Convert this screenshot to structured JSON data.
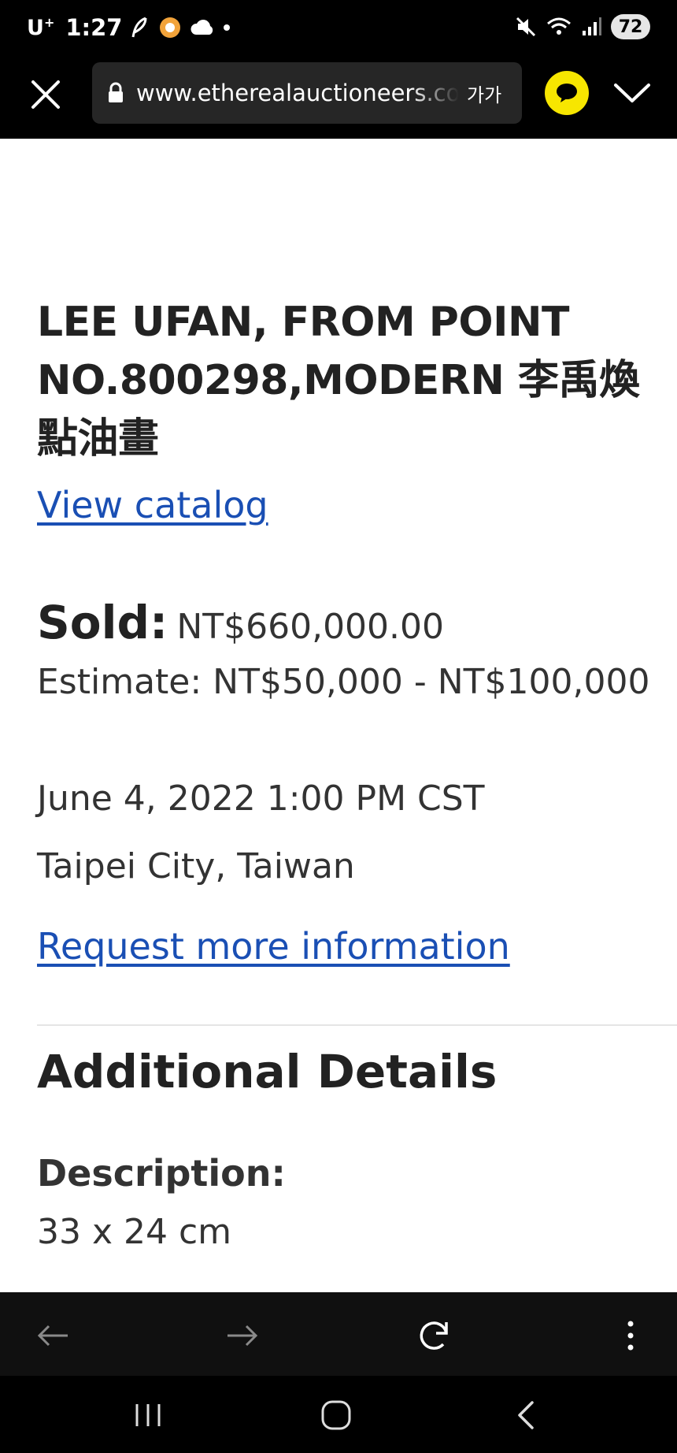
{
  "status_bar": {
    "carrier": "U",
    "carrier_sup": "+",
    "time": "1:27",
    "battery": "72"
  },
  "browser": {
    "url": "www.etherealauctioneers.com",
    "font_size_label": "가가"
  },
  "lot": {
    "title": "LEE UFAN, FROM POINT NO.800298,MODERN 李禹煥點油畫",
    "view_catalog": "View catalog",
    "sold_label": "Sold:",
    "sold_value": "NT$660,000.00",
    "estimate": "Estimate: NT$50,000 - NT$100,000",
    "date": "June 4, 2022 1:00 PM CST",
    "location": "Taipei City, Taiwan",
    "request_info": "Request more information"
  },
  "additional": {
    "heading": "Additional Details",
    "description_label": "Description:",
    "description_value": "33 x 24 cm"
  },
  "colors": {
    "link": "#1a4fb4",
    "chat_button": "#f7e600",
    "bar_background": "#000000"
  },
  "icons": {
    "close": "close-icon",
    "lock": "lock-icon",
    "chat": "chat-bubble-icon",
    "expand": "chevron-down-icon",
    "back": "arrow-left-icon",
    "forward": "arrow-right-icon",
    "reload": "reload-icon",
    "menu": "more-vert-icon",
    "recents": "recents-icon",
    "home": "home-icon",
    "system_back": "chevron-left-icon"
  }
}
